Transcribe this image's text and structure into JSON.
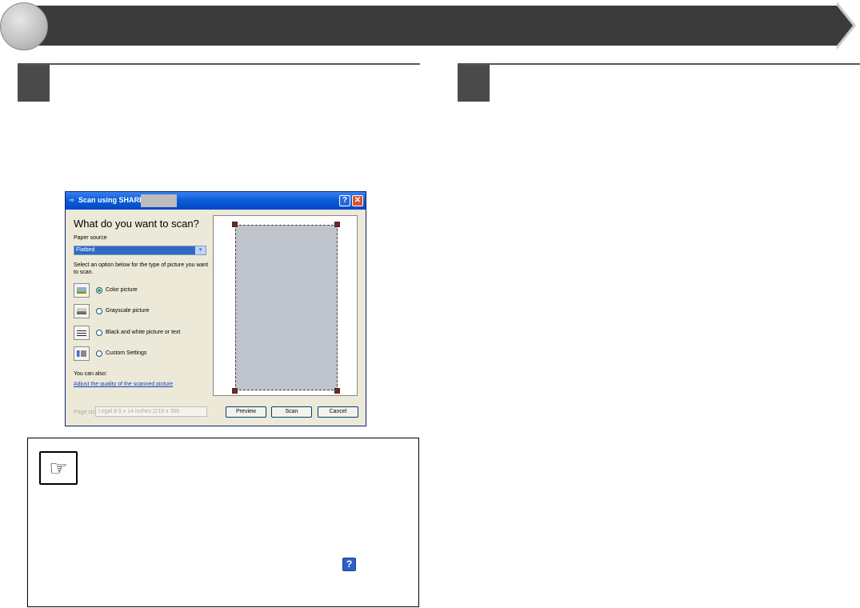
{
  "dialog": {
    "title": "Scan using SHARP",
    "heading": "What do you want to scan?",
    "paper_source_label": "Paper source",
    "paper_source_value": "Flatbed",
    "instruction": "Select an option below for the type of picture you want to scan.",
    "options": [
      {
        "label": "Color picture",
        "selected": true
      },
      {
        "label": "Grayscale picture",
        "selected": false
      },
      {
        "label": "Black and white picture or text",
        "selected": false
      },
      {
        "label": "Custom Settings",
        "selected": false
      }
    ],
    "you_can_also": "You can also:",
    "adjust_link": "Adjust the quality of the scanned picture",
    "page_size_label": "Page size:",
    "page_size_value": "Legal 8.5 x 14 inches (216 x 356",
    "buttons": {
      "preview": "Preview",
      "scan": "Scan",
      "cancel": "Cancel"
    },
    "help_glyph": "?",
    "close_glyph": "✕"
  },
  "note": {
    "icon_glyph": "☞",
    "help_glyph": "?"
  }
}
